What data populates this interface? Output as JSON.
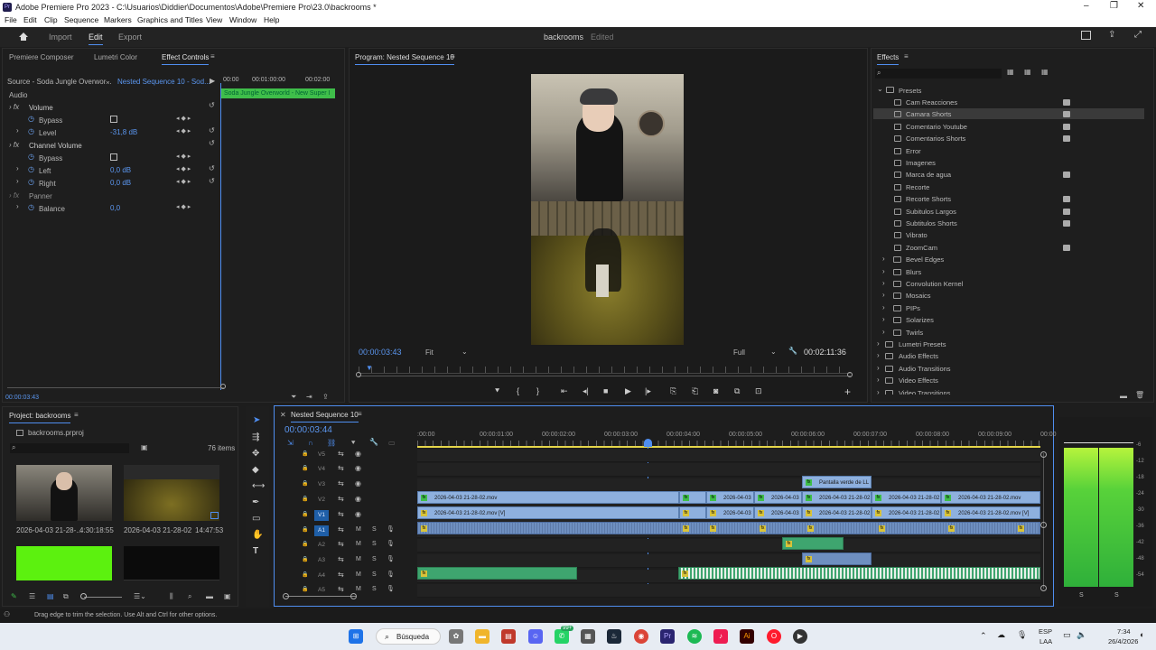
{
  "window": {
    "title": "Adobe Premiere Pro 2023 - C:\\Usuarios\\Diddier\\Documentos\\Adobe\\Premiere Pro\\23.0\\backrooms *"
  },
  "menu": [
    "File",
    "Edit",
    "Clip",
    "Sequence",
    "Markers",
    "Graphics and Titles",
    "View",
    "Window",
    "Help"
  ],
  "workspace": {
    "import": "Import",
    "edit": "Edit",
    "export": "Export",
    "project_name": "backrooms",
    "status": "Edited"
  },
  "effect_controls": {
    "tabs": [
      "Premiere Composer",
      "Lumetri Color",
      "Effect Controls"
    ],
    "source": "Source - Soda Jungle Overwor...",
    "seq": "Nested Sequence 10 - Sod...",
    "times": [
      "00:00",
      "00:01:00:00",
      "00:02:00"
    ],
    "clip_label": "Soda Jungle Overworld - New Super I",
    "audio": "Audio",
    "volume": "Volume",
    "bypass": "Bypass",
    "level": "Level",
    "level_val": "-31,8 dB",
    "channel_volume": "Channel Volume",
    "left": "Left",
    "left_val": "0,0 dB",
    "right": "Right",
    "right_val": "0,0 dB",
    "panner": "Panner",
    "balance": "Balance",
    "balance_val": "0,0",
    "timecode": "00:00:03:43"
  },
  "program": {
    "title": "Program: Nested Sequence 10",
    "timecode": "00:00:03:43",
    "fit": "Fit",
    "full": "Full",
    "duration": "00:02:11:36"
  },
  "effects": {
    "title": "Effects",
    "presets": "Presets",
    "preset_items": [
      "Cam Reacciones",
      "Camara Shorts",
      "Comentario Youtube",
      "Comentarios Shorts",
      "Error",
      "Imagenes",
      "Marca de agua",
      "Recorte",
      "Recorte Shorts",
      "Subitulos Largos",
      "Subtitulos Shorts",
      "Vibrato",
      "ZoomCam"
    ],
    "sub_folders": [
      "Bevel Edges",
      "Blurs",
      "Convolution Kernel",
      "Mosaics",
      "PIPs",
      "Solarizes",
      "Twirls"
    ],
    "top_folders": [
      "Lumetri Presets",
      "Audio Effects",
      "Audio Transitions",
      "Video Effects",
      "Video Transitions"
    ]
  },
  "project": {
    "title": "Project: backrooms",
    "file": "backrooms.prproj",
    "count": "76 items",
    "thumbs": [
      {
        "name": "2026-04-03 21-28-...",
        "dur": "4:30:18:55"
      },
      {
        "name": "2026-04-03 21-28-02",
        "dur": "14:47:53"
      }
    ]
  },
  "timeline": {
    "title": "Nested Sequence 10",
    "timecode": "00:00:03:44",
    "ruler": [
      ":00:00",
      "00:00:01:00",
      "00:00:02:00",
      "00:00:03:00",
      "00:00:04:00",
      "00:00:05:00",
      "00:00:06:00",
      "00:00:07:00",
      "00:00:08:00",
      "00:00:09:00",
      "00:00"
    ],
    "tracks": [
      "V5",
      "V4",
      "V3",
      "V2",
      "V1",
      "A1",
      "A2",
      "A3",
      "A4",
      "A5"
    ],
    "clip_v2": "2026-04-03 21-28-02.mov",
    "clip_v1": "2026-04-03 21-28-02.mov [V]",
    "clip_short": "2026-04-03",
    "clip_mid": "2026-04-03 21-28-02",
    "clip_v3": "Pantalla verde de LL",
    "m": "M",
    "s": "S"
  },
  "meter": {
    "labels": [
      "-6",
      "-12",
      "-18",
      "-24",
      "-30",
      "-36",
      "-42",
      "-48",
      "-54"
    ],
    "s": "S"
  },
  "status": "Drag edge to trim the selection. Use Alt and Ctrl for other options.",
  "taskbar": {
    "search": "Búsqueda",
    "lang1": "ESP",
    "lang2": "LAA",
    "time": "7:34",
    "date": "26/4/2026",
    "badge": "99+"
  }
}
